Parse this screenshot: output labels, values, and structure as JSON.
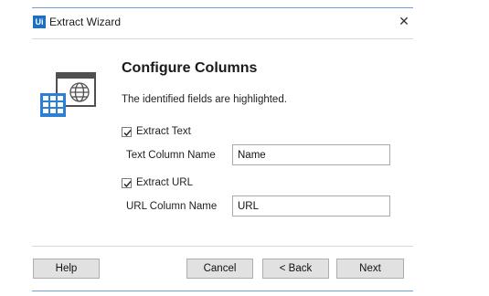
{
  "window": {
    "app_badge": "Ui",
    "title": "Extract Wizard",
    "close_glyph": "✕"
  },
  "page": {
    "heading": "Configure Columns",
    "description": "The identified fields are highlighted."
  },
  "extract_text": {
    "label": "Extract Text",
    "checked": true,
    "column_label": "Text Column Name",
    "column_value": "Name"
  },
  "extract_url": {
    "label": "Extract URL",
    "checked": true,
    "column_label": "URL Column Name",
    "column_value": "URL"
  },
  "buttons": {
    "help": "Help",
    "cancel": "Cancel",
    "back": "< Back",
    "next": "Next"
  },
  "colors": {
    "accent": "#1d6fc4",
    "illustration": "#2b7fd4",
    "rule": "#6f9fd8"
  }
}
